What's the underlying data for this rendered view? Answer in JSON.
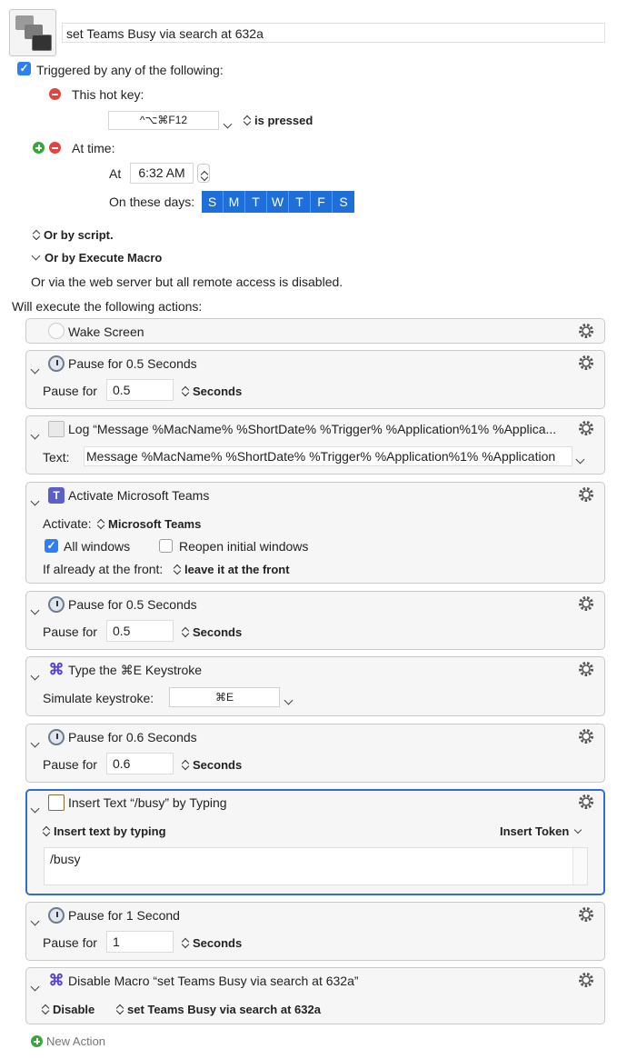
{
  "macro": {
    "name": "set Teams Busy via search at 632a"
  },
  "triggers": {
    "heading": "Triggered by any of the following:",
    "hotkey_label": "This hot key:",
    "hotkey_value": "^⌥⌘F12",
    "hotkey_mode": "is pressed",
    "time_label": "At time:",
    "at_label": "At",
    "time_value": "6:32 AM",
    "days_label": "On these days:",
    "days": [
      "S",
      "M",
      "T",
      "W",
      "T",
      "F",
      "S"
    ],
    "or_script": "Or by script.",
    "or_execute": "Or by Execute Macro",
    "web_note": "Or via the web server but all remote access is disabled."
  },
  "actions_heading": "Will execute the following actions:",
  "actions": {
    "wake": {
      "title": "Wake Screen"
    },
    "pause1": {
      "title": "Pause for 0.5 Seconds",
      "label": "Pause for",
      "value": "0.5",
      "unit": "Seconds"
    },
    "log": {
      "title": "Log “Message %MacName% %ShortDate% %Trigger% %Application%1% %Applica...",
      "label": "Text:",
      "value": "Message %MacName% %ShortDate% %Trigger% %Application%1% %Application"
    },
    "activate": {
      "title": "Activate Microsoft Teams",
      "label": "Activate:",
      "app": "Microsoft Teams",
      "all_windows": "All windows",
      "reopen": "Reopen initial windows",
      "front_label": "If already at the front:",
      "front_value": "leave it at the front"
    },
    "pause2": {
      "title": "Pause for 0.5 Seconds",
      "label": "Pause for",
      "value": "0.5",
      "unit": "Seconds"
    },
    "keystroke": {
      "title": "Type the ⌘E Keystroke",
      "label": "Simulate keystroke:",
      "value": "⌘E"
    },
    "pause3": {
      "title": "Pause for 0.6 Seconds",
      "label": "Pause for",
      "value": "0.6",
      "unit": "Seconds"
    },
    "insert": {
      "title": "Insert Text “/busy” by Typing",
      "mode": "Insert text by typing",
      "token": "Insert Token",
      "text": "/busy"
    },
    "pause4": {
      "title": "Pause for 1 Second",
      "label": "Pause for",
      "value": "1",
      "unit": "Seconds"
    },
    "disable": {
      "title": "Disable Macro “set Teams Busy via search at 632a”",
      "mode": "Disable",
      "target": "set Teams Busy via search at 632a"
    }
  },
  "new_action": "New Action",
  "colors": {
    "accent": "#1f6fdb",
    "selection_border": "#2f6fd1"
  }
}
